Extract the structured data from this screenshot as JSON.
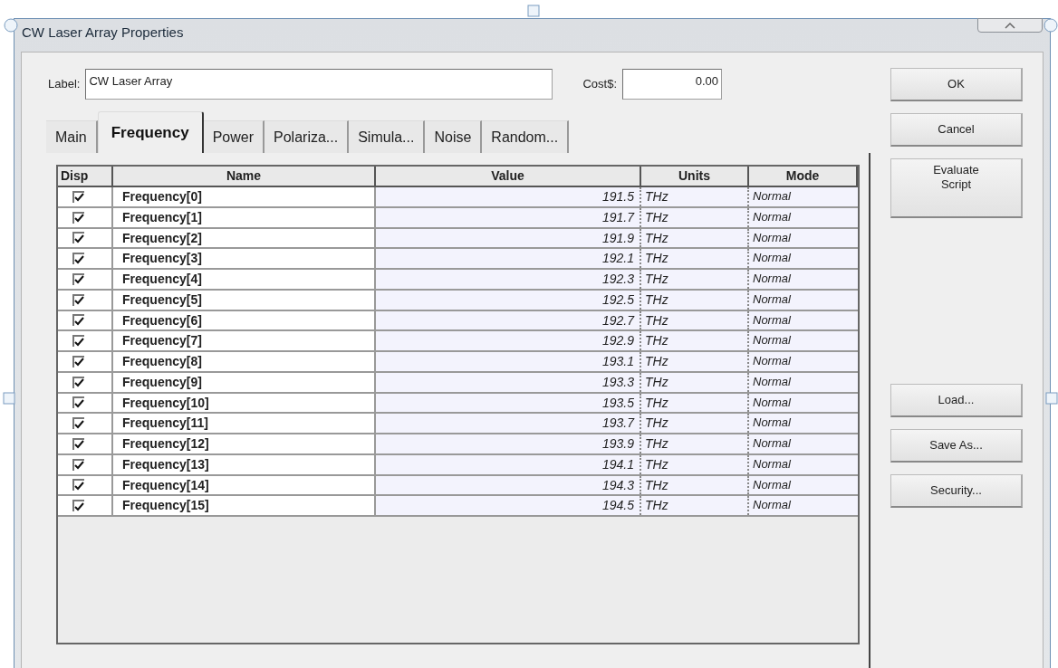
{
  "window": {
    "title": "CW Laser Array Properties"
  },
  "label_field": {
    "label": "Label:",
    "value": "CW Laser Array"
  },
  "cost_field": {
    "label": "Cost$:",
    "value": "0.00"
  },
  "tabs": [
    {
      "label": "Main",
      "selected": false
    },
    {
      "label": "Frequency",
      "selected": true
    },
    {
      "label": "Power",
      "selected": false
    },
    {
      "label": "Polariza...",
      "selected": false
    },
    {
      "label": "Simula...",
      "selected": false
    },
    {
      "label": "Noise",
      "selected": false
    },
    {
      "label": "Random...",
      "selected": false
    }
  ],
  "table": {
    "columns": [
      "Disp",
      "Name",
      "Value",
      "Units",
      "Mode"
    ],
    "rows": [
      {
        "disp": true,
        "name": "Frequency[0]",
        "value": "191.5",
        "units": "THz",
        "mode": "Normal"
      },
      {
        "disp": true,
        "name": "Frequency[1]",
        "value": "191.7",
        "units": "THz",
        "mode": "Normal"
      },
      {
        "disp": true,
        "name": "Frequency[2]",
        "value": "191.9",
        "units": "THz",
        "mode": "Normal"
      },
      {
        "disp": true,
        "name": "Frequency[3]",
        "value": "192.1",
        "units": "THz",
        "mode": "Normal"
      },
      {
        "disp": true,
        "name": "Frequency[4]",
        "value": "192.3",
        "units": "THz",
        "mode": "Normal"
      },
      {
        "disp": true,
        "name": "Frequency[5]",
        "value": "192.5",
        "units": "THz",
        "mode": "Normal"
      },
      {
        "disp": true,
        "name": "Frequency[6]",
        "value": "192.7",
        "units": "THz",
        "mode": "Normal"
      },
      {
        "disp": true,
        "name": "Frequency[7]",
        "value": "192.9",
        "units": "THz",
        "mode": "Normal"
      },
      {
        "disp": true,
        "name": "Frequency[8]",
        "value": "193.1",
        "units": "THz",
        "mode": "Normal"
      },
      {
        "disp": true,
        "name": "Frequency[9]",
        "value": "193.3",
        "units": "THz",
        "mode": "Normal"
      },
      {
        "disp": true,
        "name": "Frequency[10]",
        "value": "193.5",
        "units": "THz",
        "mode": "Normal"
      },
      {
        "disp": true,
        "name": "Frequency[11]",
        "value": "193.7",
        "units": "THz",
        "mode": "Normal"
      },
      {
        "disp": true,
        "name": "Frequency[12]",
        "value": "193.9",
        "units": "THz",
        "mode": "Normal"
      },
      {
        "disp": true,
        "name": "Frequency[13]",
        "value": "194.1",
        "units": "THz",
        "mode": "Normal"
      },
      {
        "disp": true,
        "name": "Frequency[14]",
        "value": "194.3",
        "units": "THz",
        "mode": "Normal"
      },
      {
        "disp": true,
        "name": "Frequency[15]",
        "value": "194.5",
        "units": "THz",
        "mode": "Normal"
      }
    ]
  },
  "buttons_top": [
    "OK",
    "Cancel",
    "Evaluate Script"
  ],
  "buttons_bottom": [
    "Load...",
    "Save As...",
    "Security..."
  ]
}
